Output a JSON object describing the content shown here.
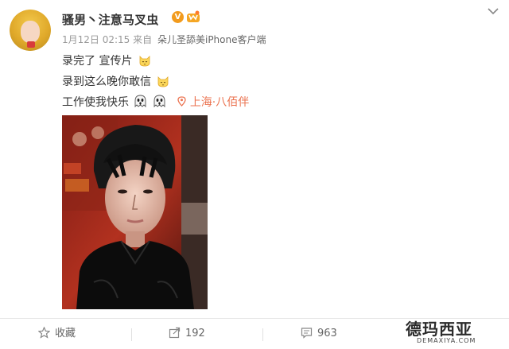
{
  "post": {
    "username": "骚男丶注意马叉虫",
    "verified_mark": "V",
    "date": "1月12日 02:15",
    "source_prefix": "来自",
    "source": "朵儿圣舔美iPhone客户端",
    "lines": [
      "录完了 宣传片",
      "录到这么晚你敢信",
      "工作使我快乐"
    ],
    "location": "上海·八佰伴",
    "colors": {
      "accent": "#eb7350",
      "verified": "#f29b1d",
      "text": "#333333",
      "meta": "#999999"
    }
  },
  "actions": {
    "favorite": {
      "label": "收藏",
      "icon": "star-icon"
    },
    "repost": {
      "count": "192",
      "icon": "share-icon"
    },
    "comment": {
      "count": "963",
      "icon": "comment-icon"
    }
  },
  "watermark": {
    "title": "德玛西亚",
    "url": "DEMAXIYA.COM"
  }
}
